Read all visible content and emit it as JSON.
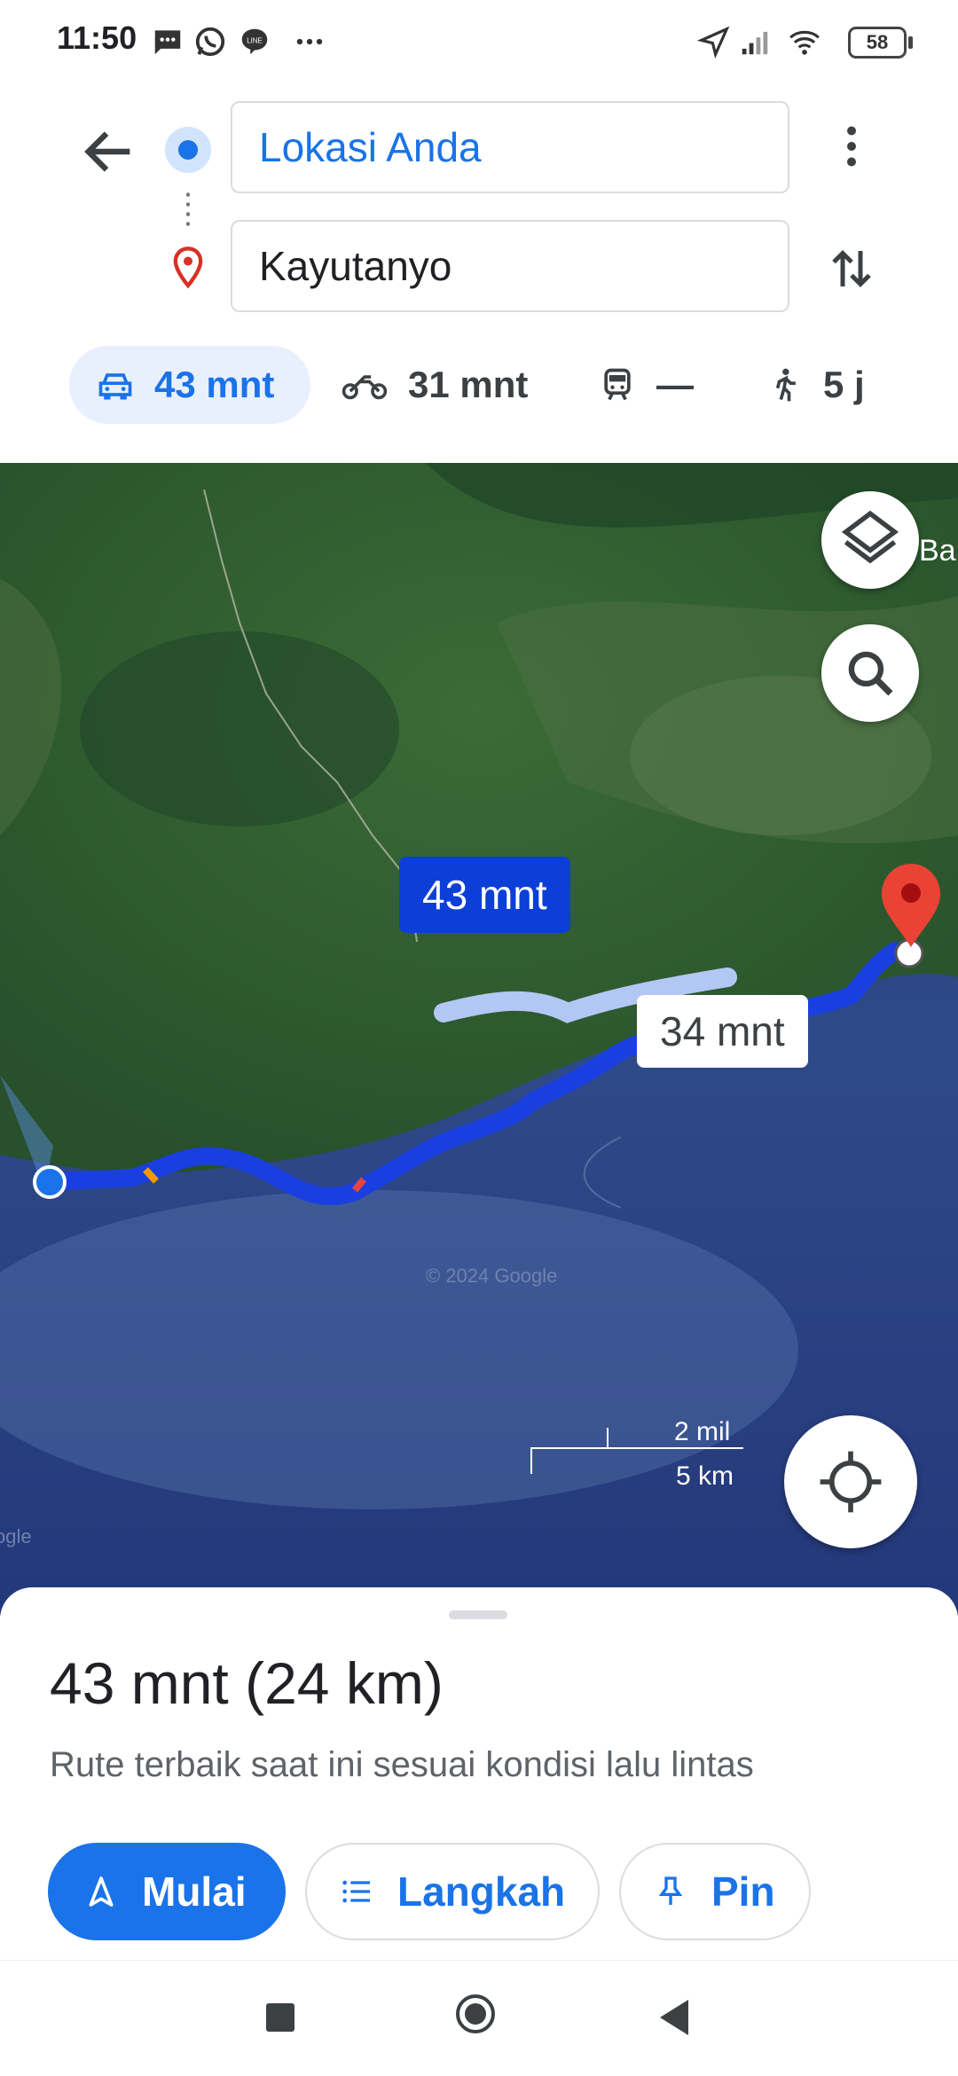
{
  "status_bar": {
    "time": "11:50",
    "battery": "58",
    "icons": [
      "message-icon",
      "whatsapp-icon",
      "line-icon",
      "more-dots-icon",
      "location-arrow-icon",
      "signal-icon",
      "wifi-icon",
      "battery-icon"
    ]
  },
  "directions": {
    "origin": "Lokasi Anda",
    "destination": "Kayutanyo"
  },
  "modes": [
    {
      "label": "43 mnt",
      "icon": "car-icon",
      "active": true
    },
    {
      "label": "31 mnt",
      "icon": "motorcycle-icon",
      "active": false
    },
    {
      "label": "—",
      "icon": "train-icon",
      "active": false
    },
    {
      "label": "5 j",
      "icon": "walk-icon",
      "active": false
    }
  ],
  "map": {
    "primary_route_label": "43 mnt",
    "alt_route_label": "34 mnt",
    "place_label": "Ba",
    "watermark": "© 2024 Google",
    "watermark_edge": "ogle",
    "scale_miles": "2 mil",
    "scale_km": "5 km",
    "colors": {
      "route": "#1a3fe0",
      "alt_route": "#b3c7f5",
      "pin": "#d93025",
      "sea": "#2e4a84",
      "land": "#2f5a2e"
    }
  },
  "sheet": {
    "summary_time": "43 mnt",
    "summary_distance": "(24 km)",
    "subtitle": "Rute terbaik saat ini sesuai kondisi lalu lintas",
    "buttons": {
      "start": "Mulai",
      "steps": "Langkah",
      "pin": "Pin"
    }
  },
  "accent": "#1a73e8"
}
